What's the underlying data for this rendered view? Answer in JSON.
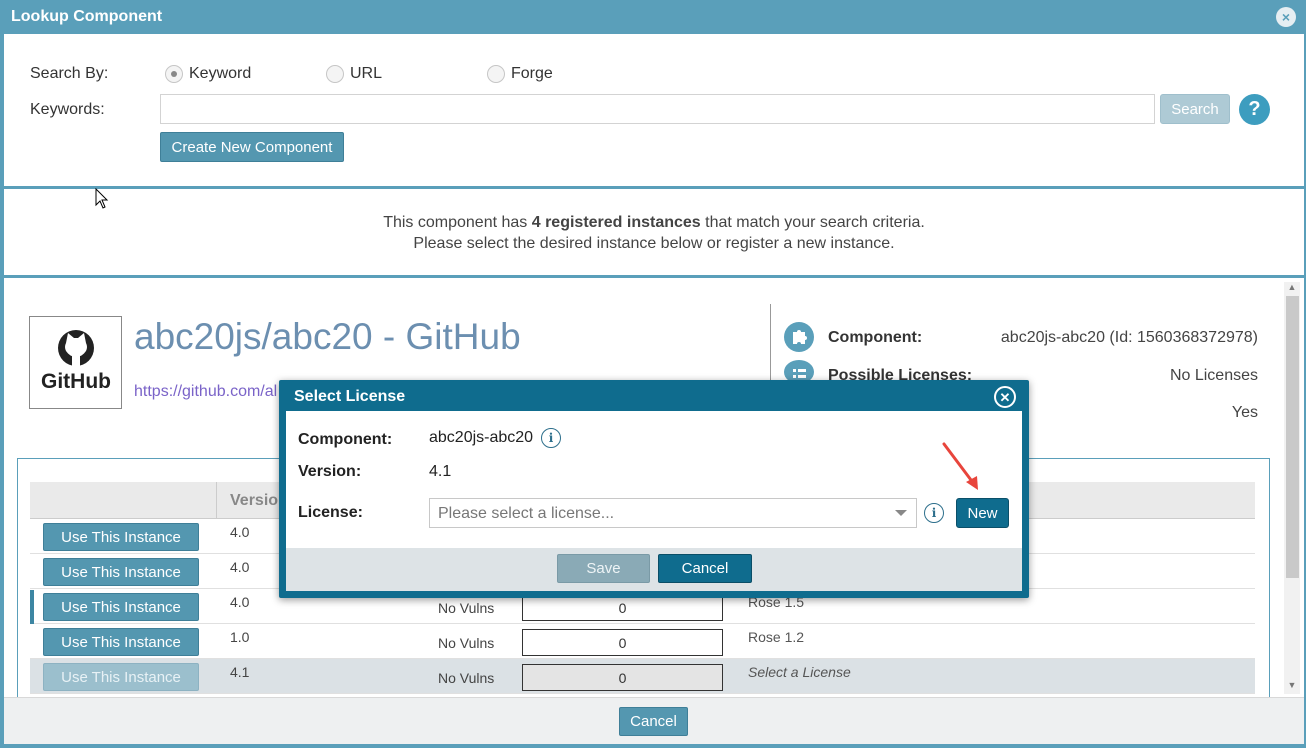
{
  "window": {
    "title": "Lookup Component",
    "close_icon": "×"
  },
  "search": {
    "search_by_label": "Search By",
    "options": [
      "Keyword",
      "URL",
      "Forge"
    ],
    "selected": "Keyword",
    "keywords_label": "Keywords",
    "keywords_value": "",
    "search_button": "Search",
    "help_icon": "?",
    "create_button": "Create New Component"
  },
  "message": {
    "pre": "This component has ",
    "bold": "4 registered instances",
    "post": " that match your search criteria.",
    "line2": "Please select the desired instance below or register a new instance."
  },
  "component": {
    "logo_text": "GitHub",
    "title": "abc20js/abc20 - GitHub",
    "link": "https://github.com/al",
    "details": [
      {
        "key": "Component:",
        "value": "abc20js-abc20 (Id: 1560368372978)",
        "icon": "puzzle-icon"
      },
      {
        "key": "Possible Licenses:",
        "value": "No Licenses",
        "icon": "list-icon"
      },
      {
        "key": "",
        "value": "Yes",
        "icon": ""
      }
    ]
  },
  "table": {
    "header_version": "Versio",
    "rows": [
      {
        "button": "Use This Instance",
        "version": "4.0",
        "vulns": "",
        "count": "",
        "license": ""
      },
      {
        "button": "Use This Instance",
        "version": "4.0",
        "vulns": "",
        "count": "",
        "license": ""
      },
      {
        "button": "Use This Instance",
        "version": "4.0",
        "vulns": "No Vulns",
        "count": "0",
        "license": "Rose 1.5"
      },
      {
        "button": "Use This Instance",
        "version": "1.0",
        "vulns": "No Vulns",
        "count": "0",
        "license": "Rose 1.2"
      },
      {
        "button": "Use This Instance",
        "version": "4.1",
        "vulns": "No Vulns",
        "count": "0",
        "license": "Select a License"
      }
    ]
  },
  "bottom": {
    "cancel_button": "Cancel"
  },
  "modal": {
    "title": "Select License",
    "component_label": "Component",
    "component_value": "abc20js-abc20",
    "version_label": "Version",
    "version_value": "4.1",
    "license_label": "License",
    "license_placeholder": "Please select a license...",
    "new_button": "New",
    "save_button": "Save",
    "cancel_button": "Cancel",
    "info_icon": "i"
  },
  "colors": {
    "frame": "#5a9fba",
    "modal": "#0f6c8e",
    "arrow": "#e8453c"
  }
}
